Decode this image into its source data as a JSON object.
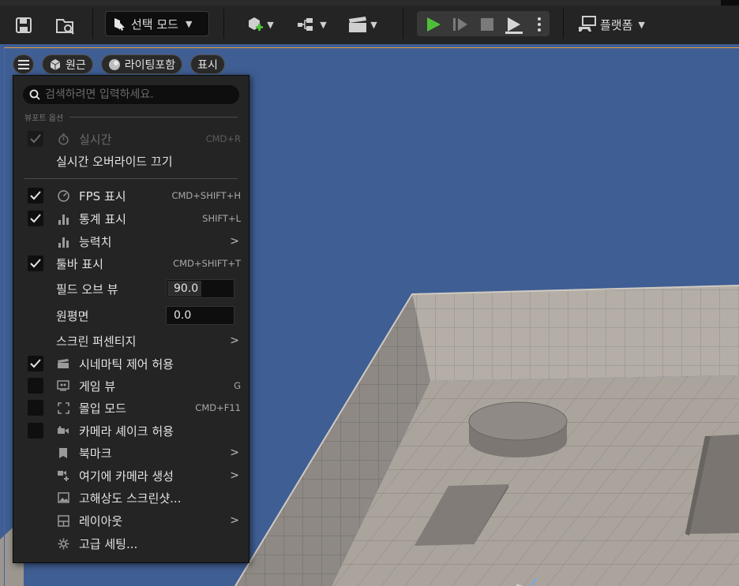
{
  "toolbar": {
    "mode_label": "선택 모드",
    "platform_label": "플랫폼"
  },
  "viewport_bar": {
    "view_mode": "원근",
    "lighting": "라이팅포함",
    "show": "표시"
  },
  "menu": {
    "search_placeholder": "검색하려면 입력하세요.",
    "section_title": "뷰포트 옵션",
    "items": [
      {
        "label": "실시간",
        "shortcut": "CMD+R",
        "checked": true,
        "disabled": true
      },
      {
        "label": "실시간 오버라이드 끄기"
      },
      {
        "label": "FPS 표시",
        "shortcut": "CMD+SHIFT+H",
        "checked": true
      },
      {
        "label": "통계 표시",
        "shortcut": "SHIFT+L",
        "checked": true
      },
      {
        "label": "능력치"
      },
      {
        "label": "툴바 표시",
        "shortcut": "CMD+SHIFT+T",
        "checked": true
      },
      {
        "label": "필드 오브 뷰",
        "value": "90.0"
      },
      {
        "label": "원평면",
        "value": "0.0"
      },
      {
        "label": "스크린 퍼센티지"
      },
      {
        "label": "시네마틱 제어 허용",
        "checked": true
      },
      {
        "label": "게임 뷰",
        "shortcut": "G",
        "checked": false
      },
      {
        "label": "몰입 모드",
        "shortcut": "CMD+F11",
        "checked": false
      },
      {
        "label": "카메라 셰이크 허용",
        "checked": false
      },
      {
        "label": "북마크"
      },
      {
        "label": "여기에 카메라 생성"
      },
      {
        "label": "고해상도 스크린샷..."
      },
      {
        "label": "레이아웃"
      },
      {
        "label": "고급 세팅..."
      }
    ]
  },
  "colors": {
    "sky": "#3f5e93",
    "floor": "#a9a39c",
    "menu_bg": "#242424",
    "play_green": "#4fbf3a"
  }
}
